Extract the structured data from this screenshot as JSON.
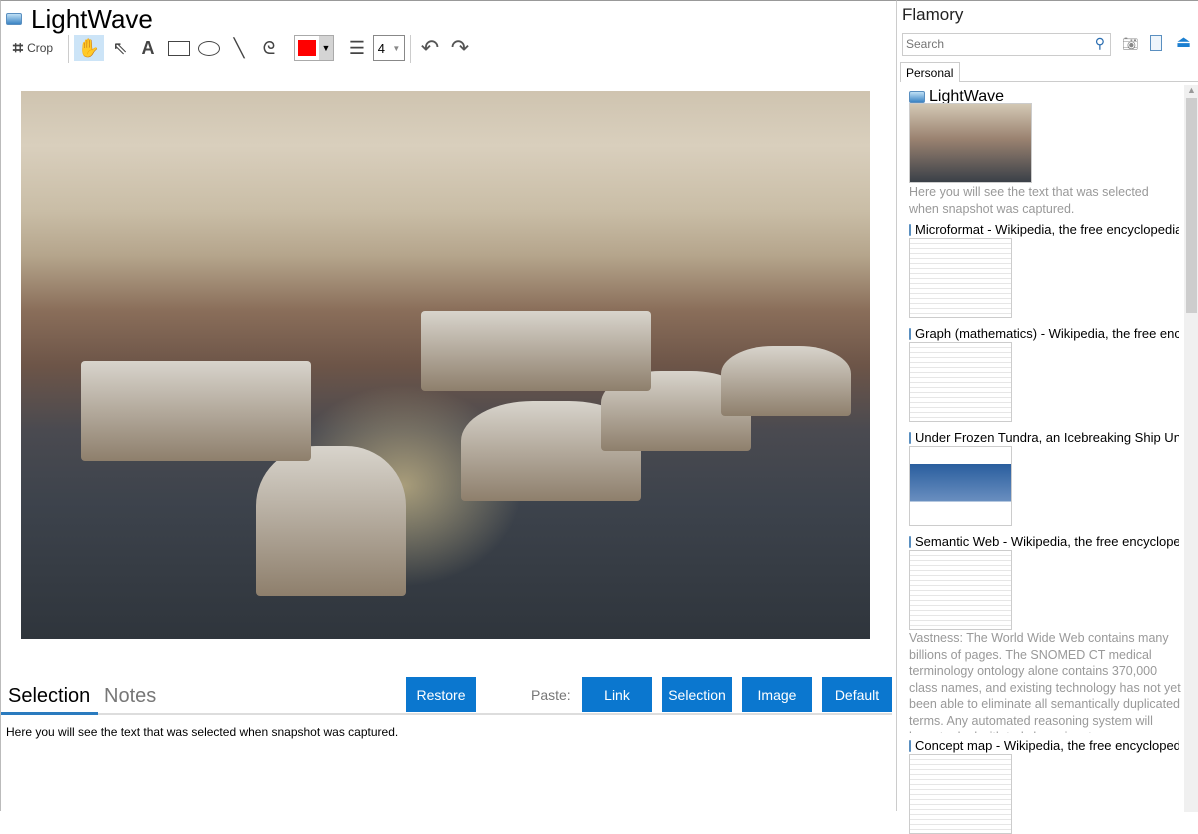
{
  "left": {
    "title": "LightWave",
    "toolbar": {
      "crop_label": "Crop",
      "line_width": "4",
      "color": "#ff0000"
    },
    "tabs": [
      {
        "label": "Selection",
        "active": true
      },
      {
        "label": "Notes",
        "active": false
      }
    ],
    "restore_label": "Restore",
    "paste_label": "Paste:",
    "paste_buttons": [
      "Link",
      "Selection",
      "Image",
      "Default"
    ],
    "selection_text": "Here you will see the text that was selected when snapshot was captured."
  },
  "right": {
    "title": "Flamory",
    "search_placeholder": "Search",
    "tab": "Personal",
    "items": [
      {
        "title": "LightWave",
        "desc": "Here you will see the text that was selected when snapshot was captured."
      },
      {
        "title": "Microformat - Wikipedia, the free encyclopedia"
      },
      {
        "title": "Graph (mathematics) - Wikipedia, the free encyclopedia"
      },
      {
        "title": "Under Frozen Tundra, an Icebreaking Ship Uncovers"
      },
      {
        "title": "Semantic Web - Wikipedia, the free encyclopedia",
        "desc": "Vastness: The World Wide Web contains many billions of pages. The SNOMED CT medical terminology ontology alone contains 370,000 class names, and existing technology has not yet been able to eliminate all semantically duplicated terms. Any automated reasoning system will have to deal with truly huge inputs."
      },
      {
        "title": "Concept map - Wikipedia, the free encyclopedia"
      }
    ]
  },
  "colors": {
    "accent": "#0b77cf"
  }
}
